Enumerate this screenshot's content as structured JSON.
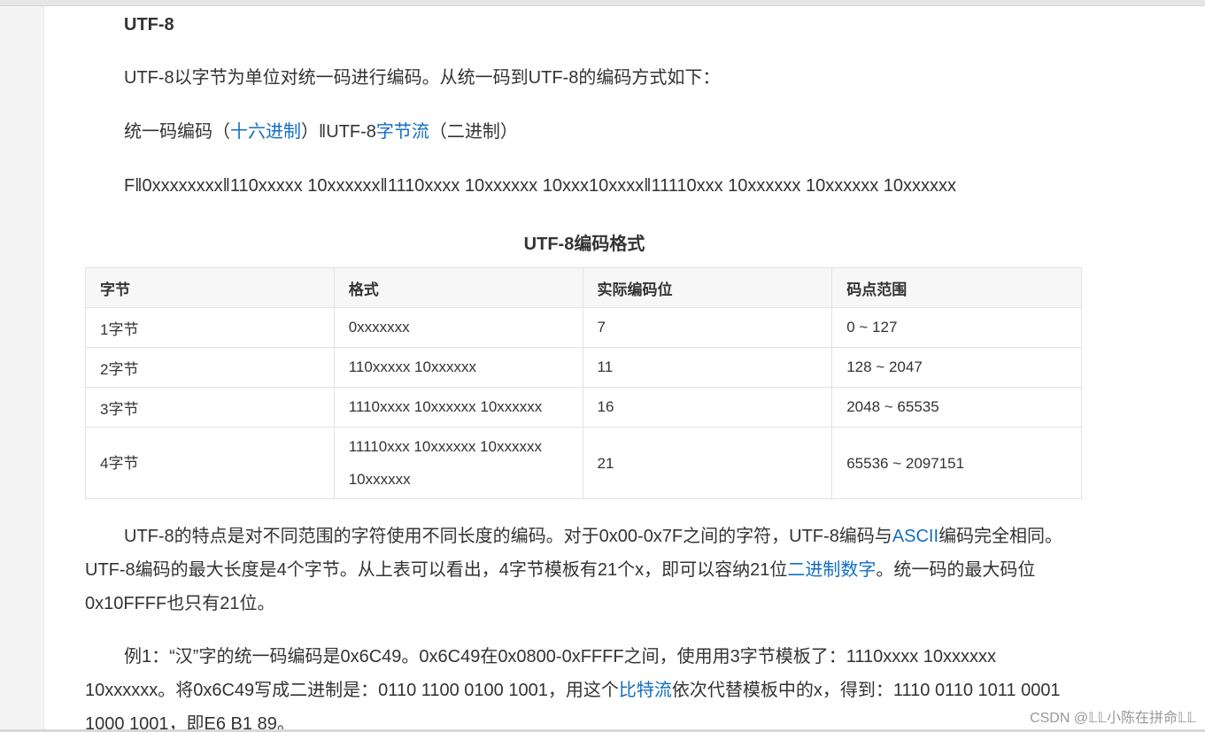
{
  "heading": "UTF-8",
  "intro": "UTF-8以字节为单位对统一码进行编码。从统一码到UTF-8的编码方式如下：",
  "mapping_line": {
    "part1": "统一码编码（",
    "link1": "十六进制",
    "part2": "）‖UTF-8",
    "link2": "字节流",
    "part3": "（二进制）"
  },
  "format_line": "F‖0xxxxxxxx‖110xxxxx 10xxxxxx‖1110xxxx 10xxxxxx 10xxx10xxxx‖11110xxx 10xxxxxx 10xxxxxx 10xxxxxx",
  "table": {
    "caption": "UTF-8编码格式",
    "headers": [
      "字节",
      "格式",
      "实际编码位",
      "码点范围"
    ],
    "rows": [
      [
        "1字节",
        "0xxxxxxx",
        "7",
        "0 ~ 127"
      ],
      [
        "2字节",
        "110xxxxx 10xxxxxx",
        "11",
        "128 ~ 2047"
      ],
      [
        "3字节",
        "1110xxxx 10xxxxxx 10xxxxxx",
        "16",
        "2048 ~ 65535"
      ],
      [
        "4字节",
        "11110xxx 10xxxxxx 10xxxxxx 10xxxxxx",
        "21",
        "65536 ~ 2097151"
      ]
    ]
  },
  "para1": {
    "l1a": "UTF-8的特点是对不同范围的字符使用不同长度的编码。对于0x00-0x7F之间的字符，UTF-8编码与",
    "l1link": "ASCII",
    "l1b": "编码完全相同。",
    "l2a": "UTF-8编码的最大长度是4个字节。从上表可以看出，4字节模板有21个x，即可以容纳21位",
    "l2link": "二进制数字",
    "l2b": "。统一码的最大码位",
    "l3": "0x10FFFF也只有21位。"
  },
  "para2": {
    "l1": "例1：“汉”字的统一码编码是0x6C49。0x6C49在0x0800-0xFFFF之间，使用用3字节模板了：1110xxxx 10xxxxxx",
    "l2a": "10xxxxxx。将0x6C49写成二进制是：0110 1100 0100 1001，用这个",
    "l2link": "比特流",
    "l2b": "依次代替模板中的x，得到：1110 0110 1011 0001",
    "l3": "1000 1001，即E6 B1 89。"
  },
  "watermark": "CSDN @𝕃𝕃小陈在拼命𝕃𝕃"
}
